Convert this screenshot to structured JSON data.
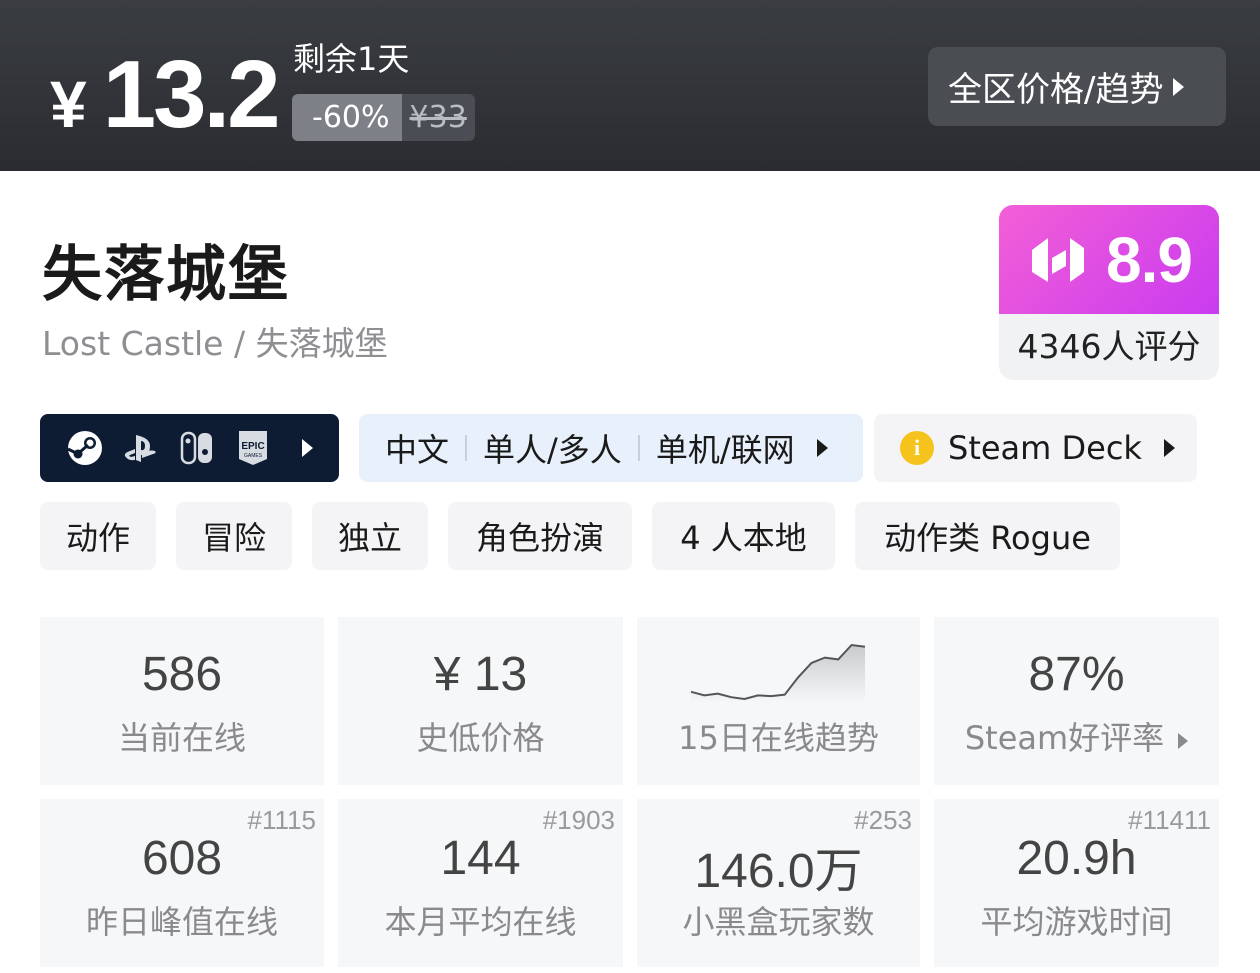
{
  "price": {
    "currency": "¥",
    "current": "13.2",
    "remaining": "剩余1天",
    "discount": "-60%",
    "original": "¥33",
    "region_button": "全区价格/趋势"
  },
  "game": {
    "title": "失落城堡",
    "subtitle": "Lost Castle / 失落城堡"
  },
  "score": {
    "value": "8.9",
    "count_label": "4346人评分"
  },
  "platforms": {
    "icons": [
      "steam-icon",
      "playstation-icon",
      "switch-icon",
      "epic-icon"
    ]
  },
  "info_chip": {
    "items": [
      "中文",
      "单人/多人",
      "单机/联网"
    ]
  },
  "deck_chip": {
    "label": "Steam Deck"
  },
  "tags": [
    "动作",
    "冒险",
    "独立",
    "角色扮演",
    "4 人本地",
    "动作类 Rogue"
  ],
  "stats": [
    {
      "value": "586",
      "label": "当前在线"
    },
    {
      "value": "¥ 13",
      "label": "史低价格"
    },
    {
      "value": "",
      "label": "15日在线趋势"
    },
    {
      "value": "87%",
      "label": "Steam好评率"
    },
    {
      "value": "608",
      "label": "昨日峰值在线",
      "rank": "#1115"
    },
    {
      "value": "144",
      "label": "本月平均在线",
      "rank": "#1903"
    },
    {
      "value": "146.0万",
      "label": "小黑盒玩家数",
      "rank": "#253"
    },
    {
      "value": "20.9h",
      "label": "平均游戏时间",
      "rank": "#11411"
    }
  ],
  "trend": {
    "values": [
      10,
      9,
      9.5,
      8.5,
      8,
      9,
      8.8,
      9.2,
      14,
      18,
      19.5,
      19,
      23,
      22.5
    ]
  },
  "colors": {
    "header_bg": "#2f3135",
    "score_gradient_start": "#f35fd6",
    "score_gradient_end": "#c93bf0",
    "platform_bg": "#0e1c33",
    "info_bg": "#e7f0fb",
    "deck_icon": "#f6c21c"
  }
}
